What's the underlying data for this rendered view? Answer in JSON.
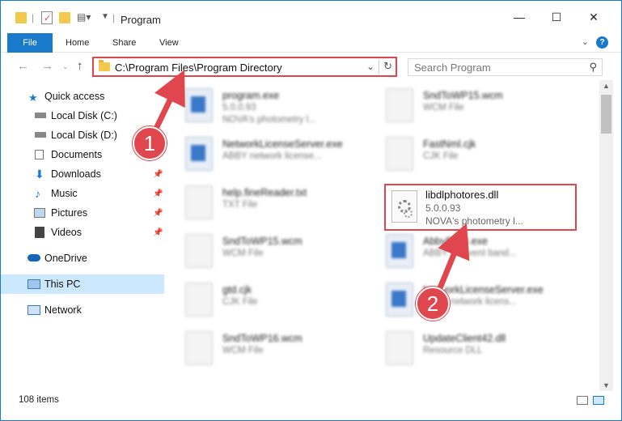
{
  "window": {
    "title": "Program",
    "minimize": "—",
    "maximize": "☐",
    "close": "✕"
  },
  "ribbon": {
    "file": "File",
    "tabs": [
      "Home",
      "Share",
      "View"
    ],
    "help": "?"
  },
  "nav": {
    "path": "C:\\Program Files\\Program Directory",
    "search_placeholder": "Search Program"
  },
  "sidebar": {
    "items": [
      {
        "label": "Quick access",
        "icon": "star-icon",
        "pinned": false
      },
      {
        "label": "Local Disk (C:)",
        "icon": "drive-icon",
        "pinned": false
      },
      {
        "label": "Local Disk (D:)",
        "icon": "drive-icon",
        "pinned": false
      },
      {
        "label": "Documents",
        "icon": "documents-icon",
        "pinned": false
      },
      {
        "label": "Downloads",
        "icon": "download-icon",
        "pinned": true
      },
      {
        "label": "Music",
        "icon": "music-icon",
        "pinned": true
      },
      {
        "label": "Pictures",
        "icon": "pictures-icon",
        "pinned": true
      },
      {
        "label": "Videos",
        "icon": "videos-icon",
        "pinned": true
      },
      {
        "label": "OneDrive",
        "icon": "cloud-icon",
        "pinned": false
      },
      {
        "label": "This PC",
        "icon": "computer-icon",
        "pinned": false
      },
      {
        "label": "Network",
        "icon": "network-icon",
        "pinned": false
      }
    ]
  },
  "files": [
    {
      "name": "program.exe",
      "line2": "5.0.0.93",
      "line3": "NOVA's photometry l...",
      "type": "exe"
    },
    {
      "name": "SndToWP15.wcm",
      "line2": "WCM File",
      "line3": "",
      "type": "doc"
    },
    {
      "name": "NetworkLicenseServer.exe",
      "line2": "ABBY network license...",
      "line3": "",
      "type": "exe"
    },
    {
      "name": "FastNml.cjk",
      "line2": "CJK File",
      "line3": "",
      "type": "doc"
    },
    {
      "name": "help.fineReader.txt",
      "line2": "TXT File",
      "line3": "",
      "type": "doc"
    },
    {
      "name": "SndToWP15.wcm",
      "line2": "WCM File",
      "line3": "",
      "type": "doc"
    },
    {
      "name": "AbbyBSTI.exe",
      "line2": "ABBY sb event band...",
      "line3": "",
      "type": "exe"
    },
    {
      "name": "gtd.cjk",
      "line2": "CJK File",
      "line3": "",
      "type": "doc"
    },
    {
      "name": "NetworkLicenseServer.exe",
      "line2": "ABBY network licens...",
      "line3": "",
      "type": "exe"
    },
    {
      "name": "SndToWP16.wcm",
      "line2": "WCM File",
      "line3": "",
      "type": "doc"
    },
    {
      "name": "UpdateClient42.dll",
      "line2": "Resource DLL",
      "line3": "",
      "type": "doc"
    }
  ],
  "highlighted_file": {
    "name": "libdlphotores.dll",
    "version": "5.0.0.93",
    "description": "NOVA's photometry l..."
  },
  "status": {
    "item_count": "108 items"
  },
  "callouts": [
    "1",
    "2"
  ],
  "colors": {
    "accent": "#1979ca",
    "highlight": "#e0464e",
    "selected": "#cce8ff"
  }
}
